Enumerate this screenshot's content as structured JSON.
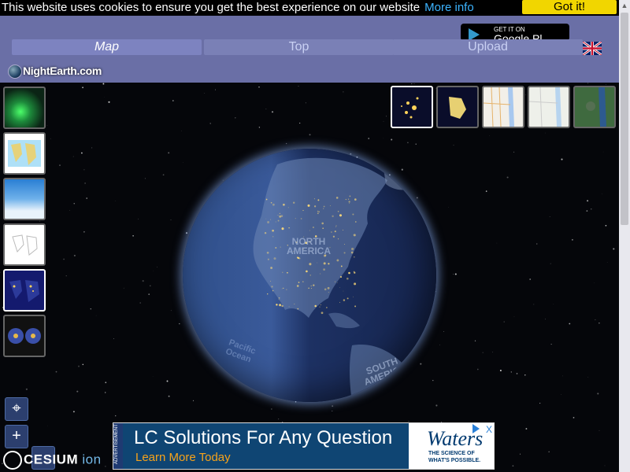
{
  "cookie": {
    "message": "This website uses cookies to ensure you get the best experience on our website",
    "more_info": "More info",
    "accept": "Got it!"
  },
  "header": {
    "tabs": [
      {
        "label": "Map",
        "active": true
      },
      {
        "label": "Top",
        "active": false
      },
      {
        "label": "Upload",
        "active": false
      }
    ],
    "store_badge": {
      "top": "GET IT ON",
      "bottom": "Google Pl"
    },
    "logo": "NightEarth.com",
    "language_flag": "uk-flag-icon"
  },
  "map": {
    "labels": [
      "NORTH AMERICA",
      "Pacific Ocean",
      "SOUTH AMERICA"
    ],
    "left_layers": [
      "aurora-thumbnail",
      "world-map-thumbnail",
      "clouds-thumbnail",
      "blank-map-thumbnail",
      "night-lights-thumbnail",
      "globes-thumbnail"
    ],
    "right_styles": [
      "night-lights-style",
      "city-lights-style",
      "road-map-style",
      "light-map-style",
      "satellite-style"
    ]
  },
  "controls": {
    "locate": "⌖",
    "zoom_in": "+",
    "cesium_main": "CESIUM",
    "cesium_ion": "ion"
  },
  "ad": {
    "label": "ADVERTISEMENT",
    "headline": "LC Solutions For Any Question",
    "cta": "Learn More Today",
    "brand": "Waters",
    "tagline": "THE SCIENCE OF WHAT'S POSSIBLE.",
    "close": "X"
  },
  "colors": {
    "header": "#6a6fa6",
    "cookie_button": "#f1d600",
    "link": "#3cb4ff"
  }
}
